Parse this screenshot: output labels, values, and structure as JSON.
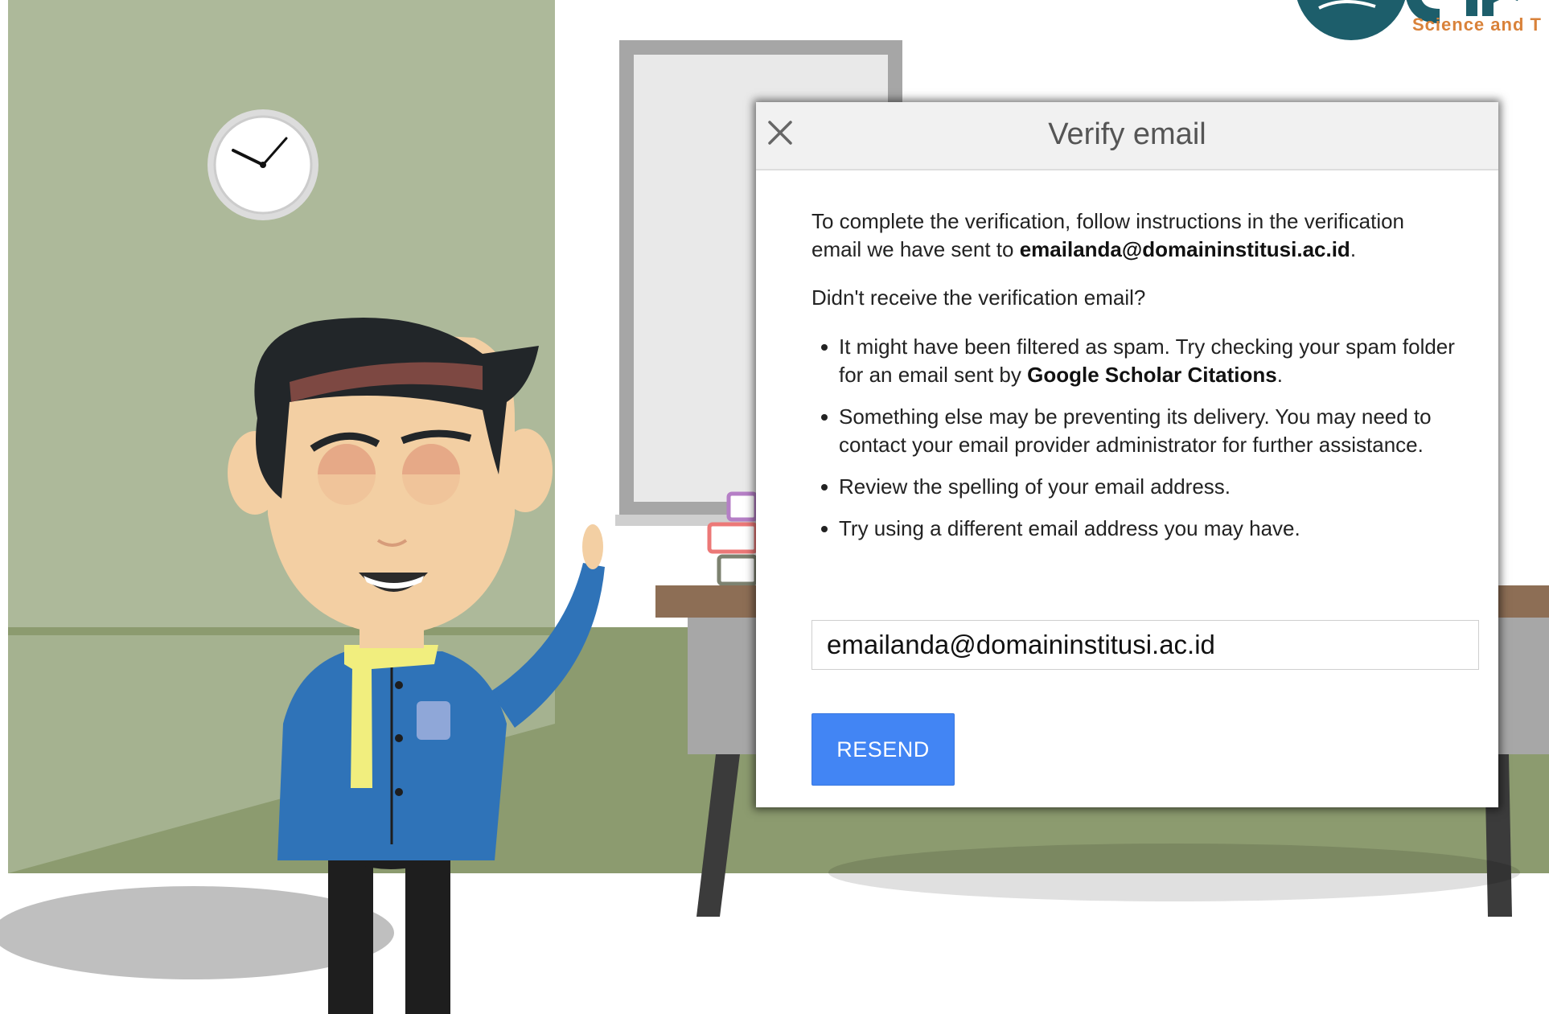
{
  "logo": {
    "tagline": "Science and T"
  },
  "dialog": {
    "title": "Verify email",
    "intro": {
      "before": "To complete the verification, follow instructions in the verification email we have sent to ",
      "email": "emailanda@domaininstitusi.ac.id",
      "after": "."
    },
    "question": "Didn't receive the verification email?",
    "bullets": {
      "spam": {
        "before": "It might have been filtered as spam. Try checking your spam folder for an email sent by ",
        "sender": "Google Scholar Citations",
        "after": "."
      },
      "other": "Something else may be preventing its delivery. You may need to contact your email provider administrator for further assistance.",
      "spelling": "Review the spelling of your email address.",
      "different": "Try using a different email address you may have."
    },
    "email_value": "emailanda@domaininstitusi.ac.id",
    "resend_label": "RESEND"
  },
  "icons": {
    "close": "close-icon",
    "clock": "clock-icon"
  },
  "colors": {
    "button": "#4285f4",
    "wall": "#adb99a",
    "floor": "#8c9b6f",
    "brand_orange": "#d9823a",
    "brand_teal": "#1d5e6b"
  }
}
